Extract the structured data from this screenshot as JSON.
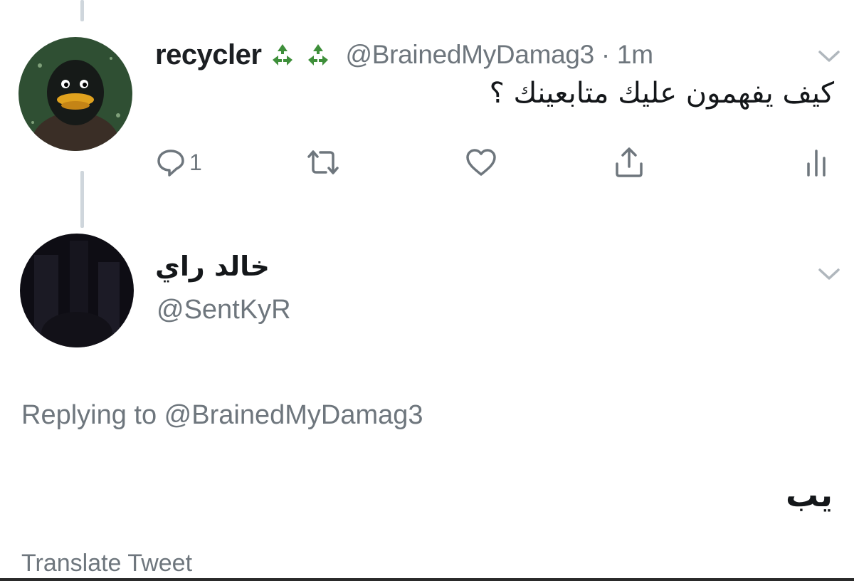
{
  "tweet": {
    "display_name": "recycler",
    "badges": [
      "recycle-icon",
      "recycle-icon"
    ],
    "handle_time": "@BrainedMyDamag3 · 1m",
    "text": "كيف يفهمون عليك متابعينك ؟",
    "actions": {
      "reply_count": "1"
    }
  },
  "reply": {
    "display_name": "خالد راي",
    "handle": "@SentKyR",
    "replying_to_prefix": "Replying to ",
    "replying_to_handle": "@BrainedMyDamag3",
    "text": "يب",
    "translate_label": "Translate Tweet"
  },
  "colors": {
    "text_primary": "#14171a",
    "text_secondary": "#6e767d",
    "thread_line": "#cfd6dc",
    "recycle_green": "#3e8f3a"
  }
}
